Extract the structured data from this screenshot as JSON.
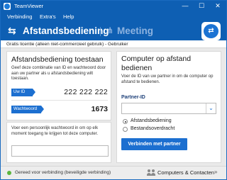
{
  "window": {
    "title": "TeamViewer",
    "minimize_glyph": "—",
    "maximize_glyph": "☐",
    "close_glyph": "✕"
  },
  "menu": {
    "items": [
      "Verbinding",
      "Extra's",
      "Help"
    ]
  },
  "tabs": {
    "remote": {
      "label": "Afstandsbediening",
      "icon": "remote-control-arrows-icon",
      "glyph": "⇆"
    },
    "meeting": {
      "label": "Meeting",
      "icon": "meeting-people-icon",
      "glyph": "⋔"
    }
  },
  "license": {
    "text": "Gratis licentie (alleen niet-commercieel gebruik) - Gebruiker"
  },
  "allow_panel": {
    "title": "Afstandsbediening toestaan",
    "description": "Geef deze combinatie van ID en wachtwoord door aan uw partner als u afstandsbediening wilt toestaan.",
    "id_label": "Uw ID",
    "id_value": "222 222 222",
    "password_label": "Wachtwoord",
    "password_value": "1673"
  },
  "personal_panel": {
    "description": "Voer een persoonlijk wachtwoord in om op elk moment toegang te krijgen tot deze computer.",
    "input_value": "",
    "edit_icon": "pencil-icon",
    "edit_glyph": "✎"
  },
  "control_panel": {
    "title": "Computer op afstand bedienen",
    "description": "Voer de ID van uw partner in om de computer op afstand te bedienen.",
    "partner_label": "Partner-ID",
    "partner_value": "",
    "dropdown_glyph": "⌄",
    "options": [
      {
        "label": "Afstandsbediening",
        "selected": true
      },
      {
        "label": "Bestandsoverdracht",
        "selected": false
      }
    ],
    "connect_label": "Verbinden met partner"
  },
  "status": {
    "text": "Gereed voor verbinding (beveiligde verbinding)",
    "color": "#5bb53e",
    "contacts_label": "Computers & Contacten",
    "contacts_glyph": "»"
  },
  "colors": {
    "brand_blue": "#0e5fb3",
    "accent_blue": "#1c6fd0"
  }
}
